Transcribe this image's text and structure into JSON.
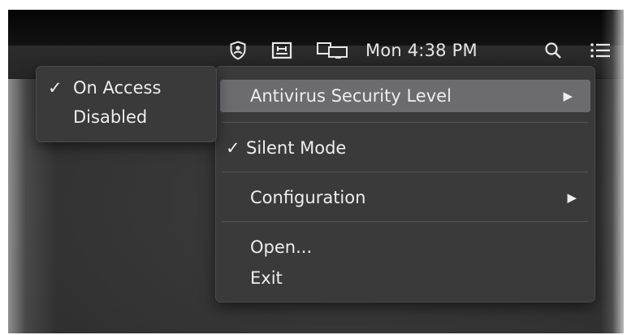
{
  "menubar": {
    "icons": [
      "antivirus-shield-icon",
      "keyboard-input-icon",
      "display-mirror-icon",
      "search-icon",
      "notification-list-icon"
    ],
    "clock": "Mon 4:38 PM"
  },
  "menu": {
    "items": [
      {
        "label": "Antivirus Security Level",
        "checked": false,
        "has_submenu": true,
        "arrow": "▶",
        "highlighted": true
      },
      {
        "label": "Silent Mode",
        "checked": true,
        "check": "✓",
        "has_submenu": false
      },
      {
        "label": "Configuration",
        "checked": false,
        "has_submenu": true,
        "arrow": "▶"
      },
      {
        "label": "Open...",
        "checked": false,
        "has_submenu": false
      },
      {
        "label": "Exit",
        "checked": false,
        "has_submenu": false
      }
    ]
  },
  "submenu": {
    "items": [
      {
        "label": "On Access",
        "checked": true,
        "check": "✓"
      },
      {
        "label": "Disabled",
        "checked": false
      }
    ]
  },
  "colors": {
    "menu_bg": "#3a3a3a",
    "highlight": "#6b6b70",
    "text": "#eeeeee"
  }
}
